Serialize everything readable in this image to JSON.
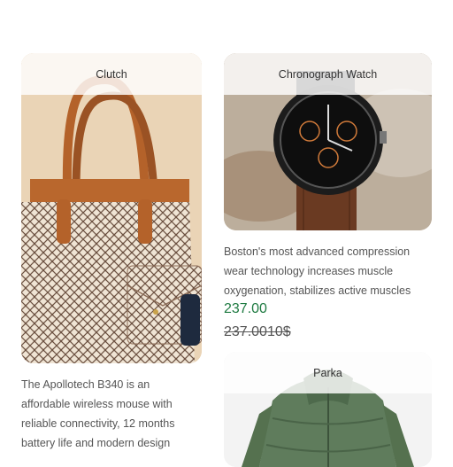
{
  "products": [
    {
      "name": "Clutch",
      "description": "The Apollotech B340 is an affordable wireless mouse with reliable connectivity, 12 months battery life and modern design",
      "desc_lines": [
        "The Apollotech B340 is an",
        "affordable wireless mouse with",
        "reliable connectivity, 12 months",
        "battery life and modern design"
      ]
    },
    {
      "name": "Chronograph Watch",
      "description": "Boston's most advanced compression wear technology increases muscle oxygenation, stabilizes active muscles",
      "desc_lines": [
        "Boston's most advanced compression",
        "wear technology increases muscle",
        "oxygenation, stabilizes active muscles"
      ],
      "price": "237.00",
      "old_price": "237.0010$"
    },
    {
      "name": "Parka"
    }
  ],
  "colors": {
    "price": "#1e7a41",
    "bag_brown": "#b9672d",
    "jacket_green": "#5f7c5c"
  }
}
